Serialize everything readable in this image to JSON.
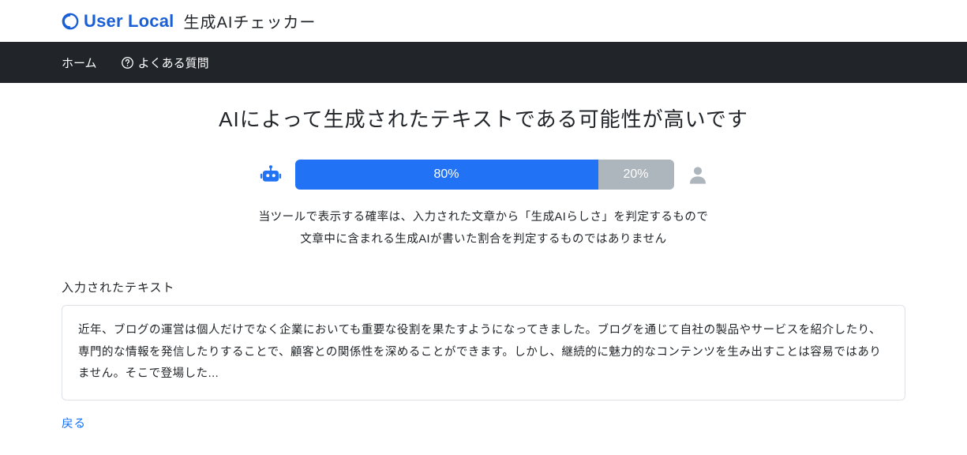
{
  "header": {
    "brand": "User Local",
    "app_title": "生成AIチェッカー"
  },
  "nav": {
    "home": "ホーム",
    "faq": "よくある質問"
  },
  "result": {
    "heading": "AIによって生成されたテキストである可能性が高いです",
    "ai_percent": 80,
    "ai_percent_label": "80%",
    "human_percent": 20,
    "human_percent_label": "20%",
    "disclaimer_line1": "当ツールで表示する確率は、入力された文章から「生成AIらしさ」を判定するもので",
    "disclaimer_line2": "文章中に含まれる生成AIが書いた割合を判定するものではありません"
  },
  "input_section": {
    "label": "入力されたテキスト",
    "text": "近年、ブログの運営は個人だけでなく企業においても重要な役割を果たすようになってきました。ブログを通じて自社の製品やサービスを紹介したり、専門的な情報を発信したりすることで、顧客との関係性を深めることができます。しかし、継続的に魅力的なコンテンツを生み出すことは容易ではありません。そこで登場した..."
  },
  "actions": {
    "back": "戻る"
  }
}
